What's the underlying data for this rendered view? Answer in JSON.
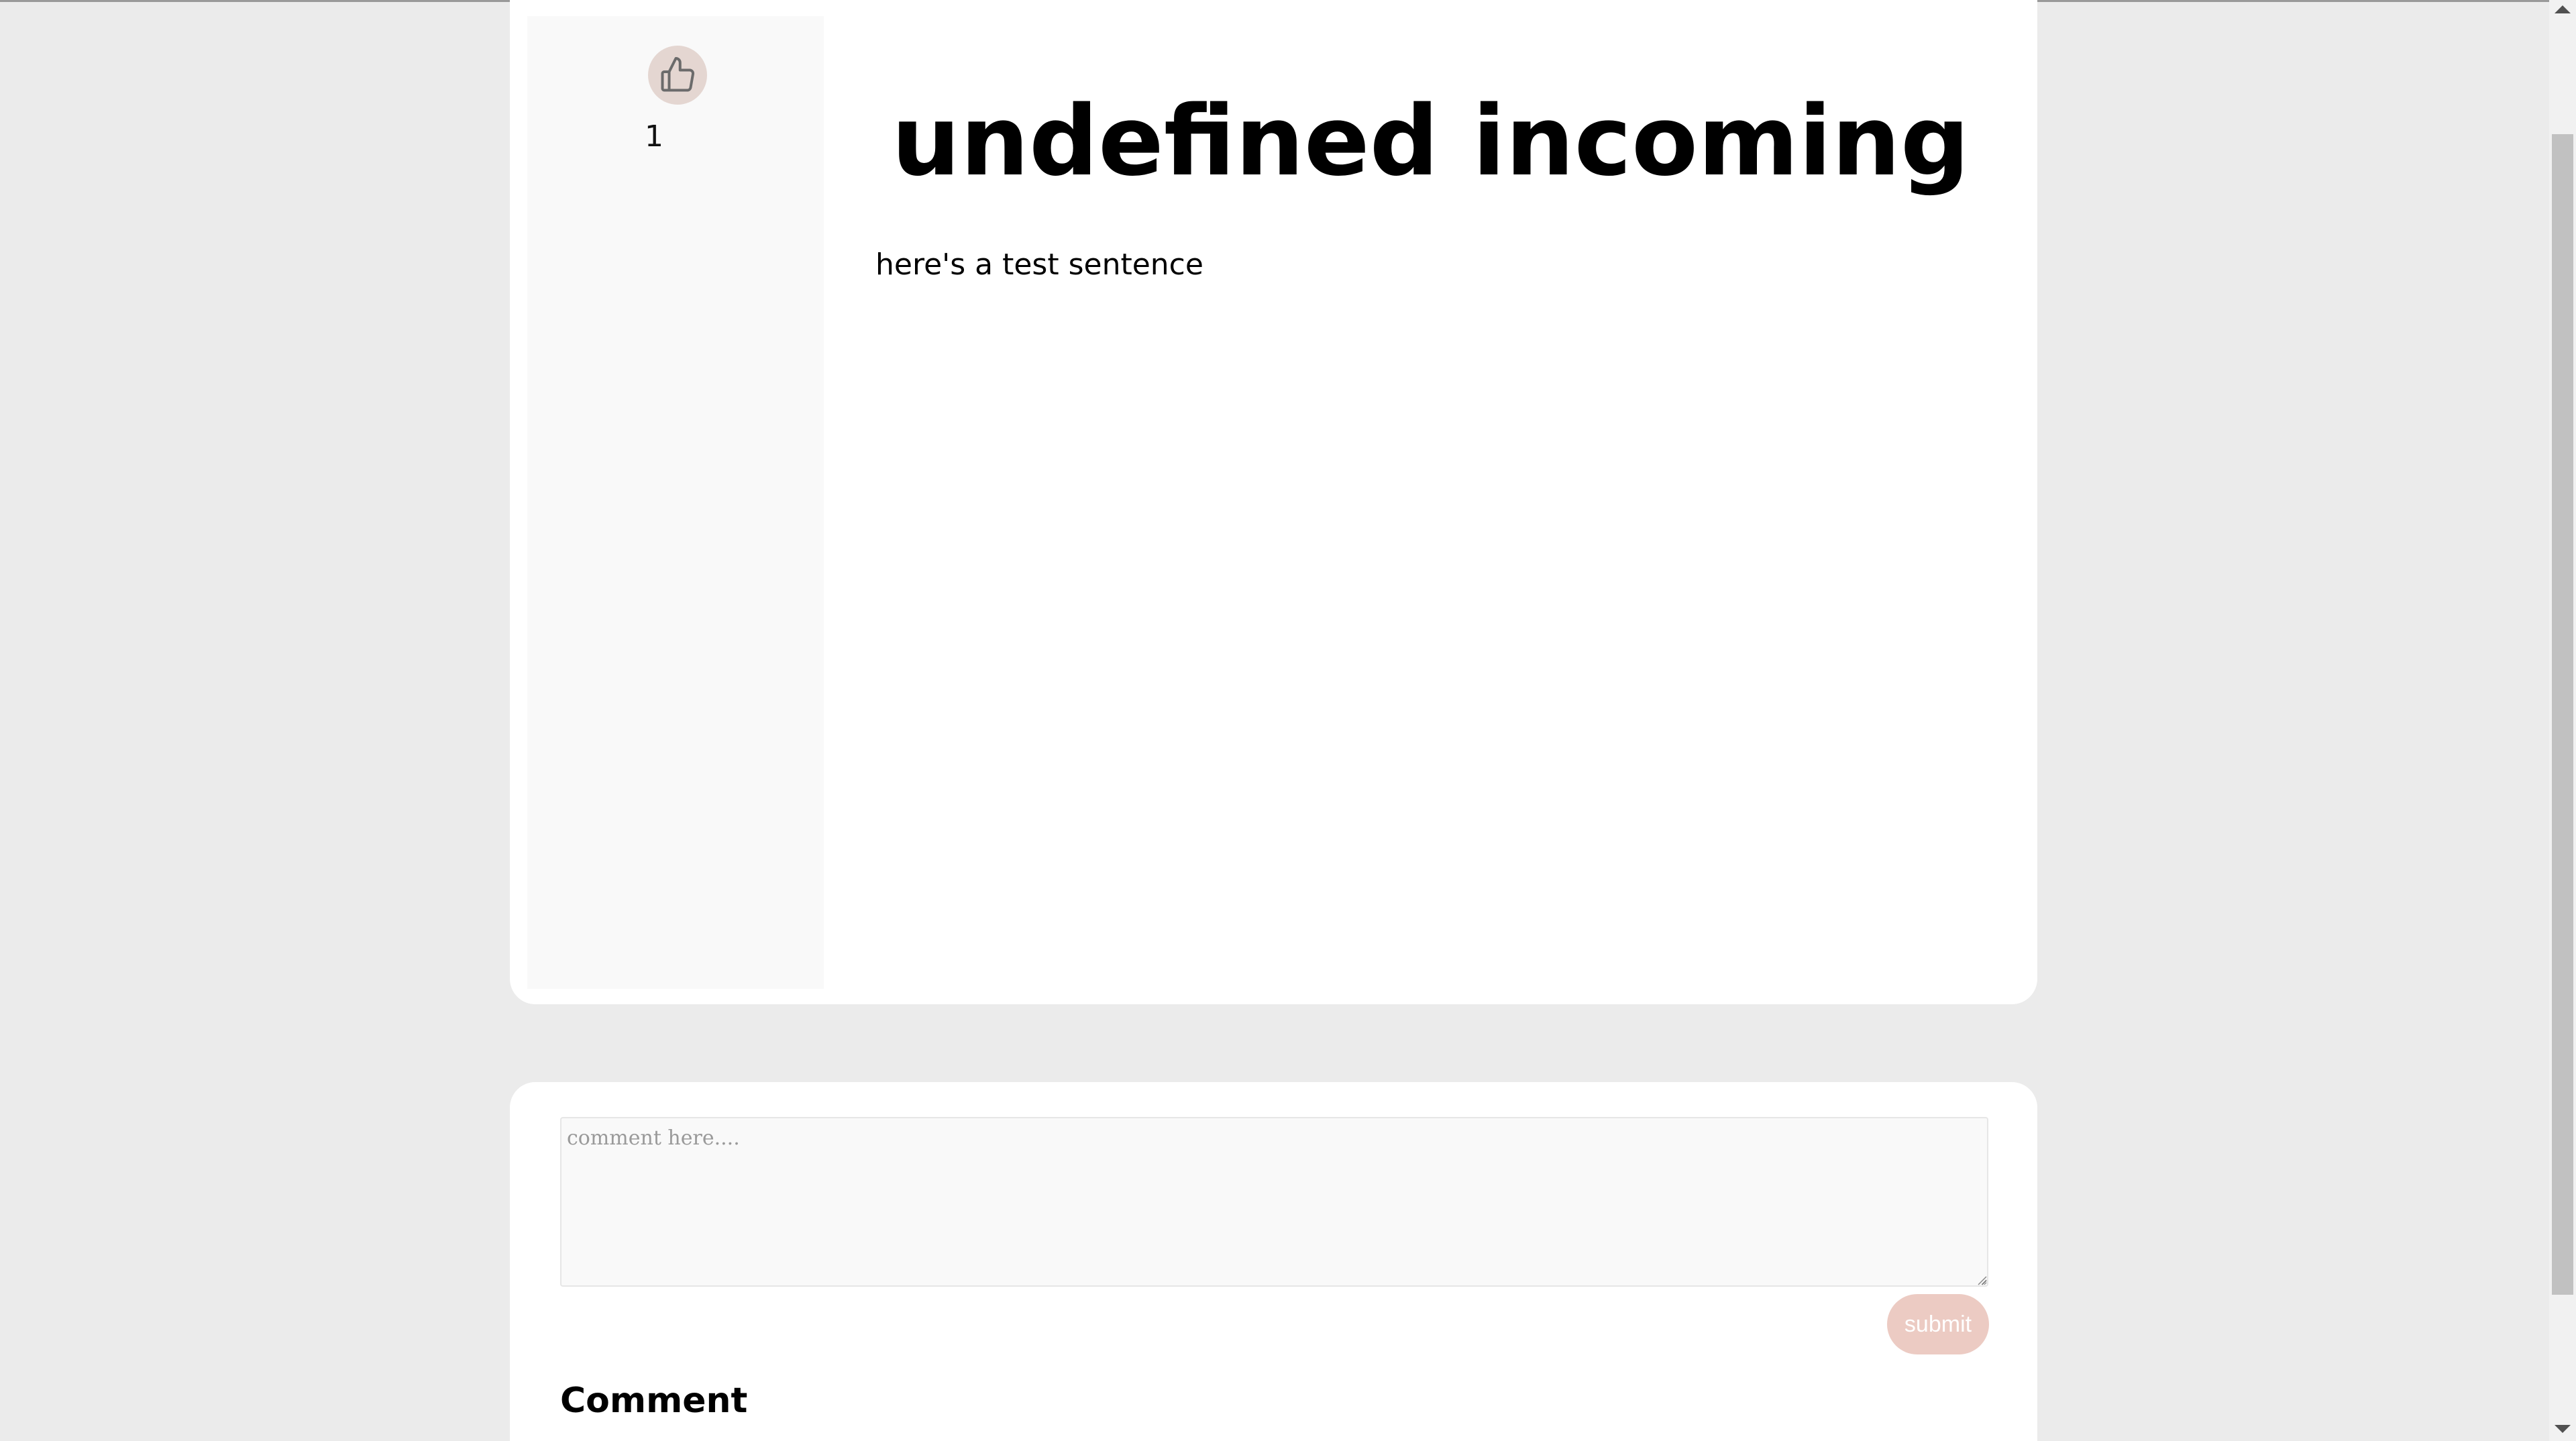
{
  "post": {
    "title": "undefined incoming",
    "body": "here's a test sentence",
    "like_count": "1",
    "like_icon": "thumbs-up-icon"
  },
  "comment_form": {
    "placeholder": "comment here....",
    "value": "",
    "submit_label": "submit"
  },
  "comments": {
    "heading": "Comment"
  },
  "colors": {
    "page_background": "#ebebeb",
    "card_background": "#ffffff",
    "vote_column_background": "#f9f9f9",
    "like_button_background": "#e4d6d1",
    "submit_button_background": "#eccbc3"
  }
}
